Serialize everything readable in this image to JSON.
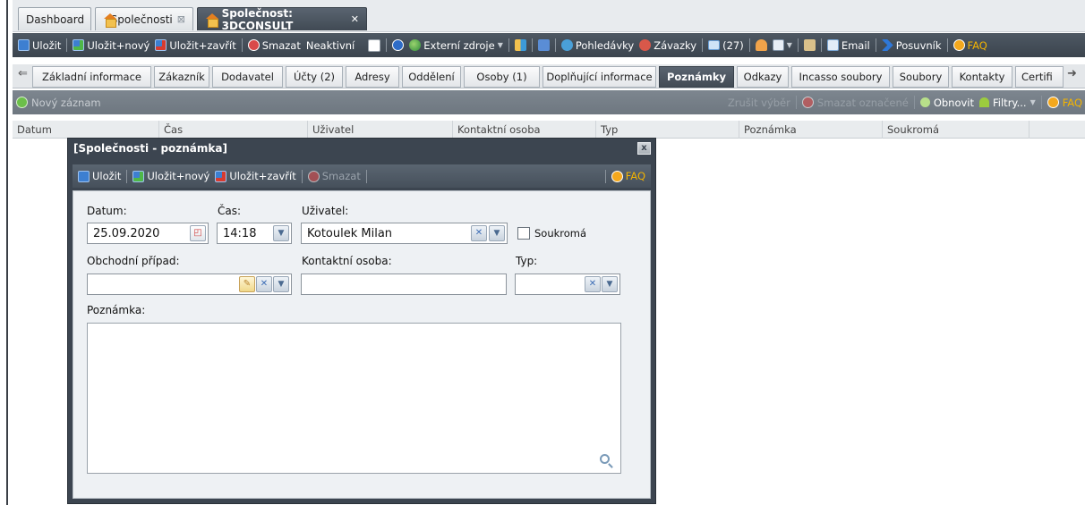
{
  "top_tabs": [
    {
      "label": "Dashboard"
    },
    {
      "label": "Společnosti",
      "close": "⊠"
    },
    {
      "label": "Společnost: 3DCONSULT",
      "close": "✕"
    }
  ],
  "toolbar": {
    "save": "Uložit",
    "save_new": "Uložit+nový",
    "save_close": "Uložit+zavřít",
    "delete": "Smazat",
    "inactive": "Neaktivní",
    "external_sources": "Externí zdroje",
    "receivables": "Pohledávky",
    "payables": "Závazky",
    "mail_count": "(27)",
    "email": "Email",
    "posuvnik": "Posuvník",
    "faq": "FAQ"
  },
  "sub_tabs": [
    {
      "label": "Základní informace"
    },
    {
      "label": "Zákazník"
    },
    {
      "label": "Dodavatel"
    },
    {
      "label": "Účty (2)"
    },
    {
      "label": "Adresy"
    },
    {
      "label": "Oddělení"
    },
    {
      "label": "Osoby (1)"
    },
    {
      "label": "Doplňující informace"
    },
    {
      "label": "Poznámky"
    },
    {
      "label": "Odkazy"
    },
    {
      "label": "Incasso soubory"
    },
    {
      "label": "Soubory"
    },
    {
      "label": "Kontakty"
    },
    {
      "label": "Certifi"
    }
  ],
  "actionbar": {
    "new_record": "Nový záznam",
    "cancel_selection": "Zrušit výběr",
    "delete_selected": "Smazat označené",
    "refresh": "Obnovit",
    "filters": "Filtry...",
    "faq": "FAQ"
  },
  "grid": {
    "columns": [
      "Datum",
      "Čas",
      "Uživatel",
      "Kontaktní osoba",
      "Typ",
      "Poznámka",
      "Soukromá"
    ]
  },
  "dialog": {
    "title": "[Společnosti - poznámka]",
    "close": "x",
    "toolbar": {
      "save": "Uložit",
      "save_new": "Uložit+nový",
      "save_close": "Uložit+zavřít",
      "delete": "Smazat",
      "faq": "FAQ"
    },
    "form": {
      "date_label": "Datum:",
      "date_value": "25.09.2020",
      "time_label": "Čas:",
      "time_value": "14:18",
      "user_label": "Uživatel:",
      "user_value": "Kotoulek Milan",
      "private_label": "Soukromá",
      "business_case_label": "Obchodní případ:",
      "business_case_value": "",
      "contact_label": "Kontaktní osoba:",
      "contact_value": "",
      "type_label": "Typ:",
      "type_value": "",
      "note_label": "Poznámka:",
      "note_value": ""
    }
  }
}
